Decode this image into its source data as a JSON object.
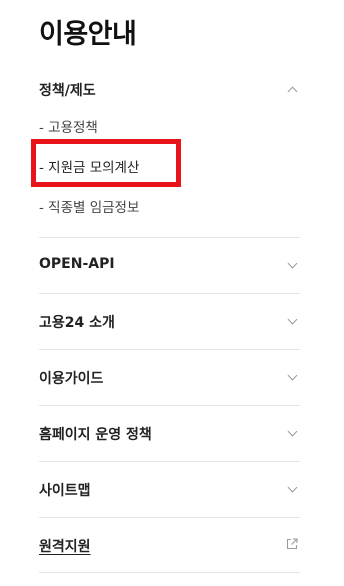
{
  "page_title": "이용안내",
  "section": {
    "label": "정책/제도",
    "expanded": true,
    "icon": "chevron-up-icon",
    "items": [
      {
        "label": "- 고용정책",
        "highlighted": false
      },
      {
        "label": "- 지원금 모의계산",
        "highlighted": true
      },
      {
        "label": "- 직종별 임금정보",
        "highlighted": false
      }
    ]
  },
  "menu": [
    {
      "label": "OPEN-API",
      "icon": "chevron-down-icon"
    },
    {
      "label": "고용24 소개",
      "icon": "chevron-down-icon"
    },
    {
      "label": "이용가이드",
      "icon": "chevron-down-icon"
    },
    {
      "label": "홈페이지 운영 정책",
      "icon": "chevron-down-icon"
    },
    {
      "label": "사이트맵",
      "icon": "chevron-down-icon"
    },
    {
      "label": "원격지원",
      "icon": "external-link-icon",
      "underlined": true
    }
  ],
  "colors": {
    "highlight": "#e8131b",
    "divider": "#e4e4e4",
    "text": "#222222",
    "muted_icon": "#9a9a9a"
  }
}
